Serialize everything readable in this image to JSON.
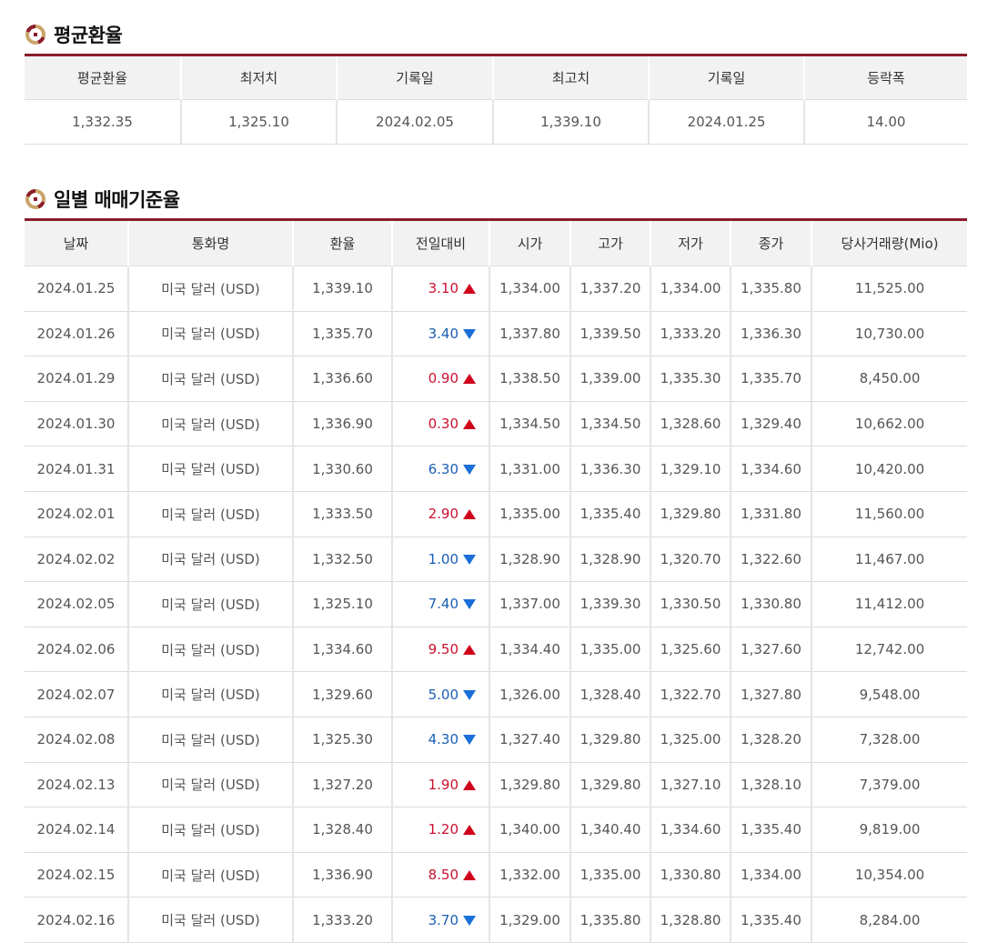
{
  "avg_section": {
    "title": "평균환율",
    "headers": [
      "평균환율",
      "최저치",
      "기록일",
      "최고치",
      "기록일",
      "등락폭"
    ],
    "values": [
      "1,332.35",
      "1,325.10",
      "2024.02.05",
      "1,339.10",
      "2024.01.25",
      "14.00"
    ]
  },
  "daily_section": {
    "title": "일별 매매기준율",
    "headers": [
      "날짜",
      "통화명",
      "환율",
      "전일대비",
      "시가",
      "고가",
      "저가",
      "종가",
      "당사거래량(Mio)"
    ],
    "rows": [
      {
        "date": "2024.01.25",
        "currency": "미국 달러 (USD)",
        "rate": "1,339.10",
        "change": "3.10",
        "direction": "up",
        "open": "1,334.00",
        "high": "1,337.20",
        "low": "1,334.00",
        "close": "1,335.80",
        "volume": "11,525.00"
      },
      {
        "date": "2024.01.26",
        "currency": "미국 달러 (USD)",
        "rate": "1,335.70",
        "change": "3.40",
        "direction": "down",
        "open": "1,337.80",
        "high": "1,339.50",
        "low": "1,333.20",
        "close": "1,336.30",
        "volume": "10,730.00"
      },
      {
        "date": "2024.01.29",
        "currency": "미국 달러 (USD)",
        "rate": "1,336.60",
        "change": "0.90",
        "direction": "up",
        "open": "1,338.50",
        "high": "1,339.00",
        "low": "1,335.30",
        "close": "1,335.70",
        "volume": "8,450.00"
      },
      {
        "date": "2024.01.30",
        "currency": "미국 달러 (USD)",
        "rate": "1,336.90",
        "change": "0.30",
        "direction": "up",
        "open": "1,334.50",
        "high": "1,334.50",
        "low": "1,328.60",
        "close": "1,329.40",
        "volume": "10,662.00"
      },
      {
        "date": "2024.01.31",
        "currency": "미국 달러 (USD)",
        "rate": "1,330.60",
        "change": "6.30",
        "direction": "down",
        "open": "1,331.00",
        "high": "1,336.30",
        "low": "1,329.10",
        "close": "1,334.60",
        "volume": "10,420.00"
      },
      {
        "date": "2024.02.01",
        "currency": "미국 달러 (USD)",
        "rate": "1,333.50",
        "change": "2.90",
        "direction": "up",
        "open": "1,335.00",
        "high": "1,335.40",
        "low": "1,329.80",
        "close": "1,331.80",
        "volume": "11,560.00"
      },
      {
        "date": "2024.02.02",
        "currency": "미국 달러 (USD)",
        "rate": "1,332.50",
        "change": "1.00",
        "direction": "down",
        "open": "1,328.90",
        "high": "1,328.90",
        "low": "1,320.70",
        "close": "1,322.60",
        "volume": "11,467.00"
      },
      {
        "date": "2024.02.05",
        "currency": "미국 달러 (USD)",
        "rate": "1,325.10",
        "change": "7.40",
        "direction": "down",
        "open": "1,337.00",
        "high": "1,339.30",
        "low": "1,330.50",
        "close": "1,330.80",
        "volume": "11,412.00"
      },
      {
        "date": "2024.02.06",
        "currency": "미국 달러 (USD)",
        "rate": "1,334.60",
        "change": "9.50",
        "direction": "up",
        "open": "1,334.40",
        "high": "1,335.00",
        "low": "1,325.60",
        "close": "1,327.60",
        "volume": "12,742.00"
      },
      {
        "date": "2024.02.07",
        "currency": "미국 달러 (USD)",
        "rate": "1,329.60",
        "change": "5.00",
        "direction": "down",
        "open": "1,326.00",
        "high": "1,328.40",
        "low": "1,322.70",
        "close": "1,327.80",
        "volume": "9,548.00"
      },
      {
        "date": "2024.02.08",
        "currency": "미국 달러 (USD)",
        "rate": "1,325.30",
        "change": "4.30",
        "direction": "down",
        "open": "1,327.40",
        "high": "1,329.80",
        "low": "1,325.00",
        "close": "1,328.20",
        "volume": "7,328.00"
      },
      {
        "date": "2024.02.13",
        "currency": "미국 달러 (USD)",
        "rate": "1,327.20",
        "change": "1.90",
        "direction": "up",
        "open": "1,329.80",
        "high": "1,329.80",
        "low": "1,327.10",
        "close": "1,328.10",
        "volume": "7,379.00"
      },
      {
        "date": "2024.02.14",
        "currency": "미국 달러 (USD)",
        "rate": "1,328.40",
        "change": "1.20",
        "direction": "up",
        "open": "1,340.00",
        "high": "1,340.40",
        "low": "1,334.60",
        "close": "1,335.40",
        "volume": "9,819.00"
      },
      {
        "date": "2024.02.15",
        "currency": "미국 달러 (USD)",
        "rate": "1,336.90",
        "change": "8.50",
        "direction": "up",
        "open": "1,332.00",
        "high": "1,335.00",
        "low": "1,330.80",
        "close": "1,334.00",
        "volume": "10,354.00"
      },
      {
        "date": "2024.02.16",
        "currency": "미국 달러 (USD)",
        "rate": "1,333.20",
        "change": "3.70",
        "direction": "down",
        "open": "1,329.00",
        "high": "1,335.80",
        "low": "1,328.80",
        "close": "1,335.40",
        "volume": "8,284.00"
      }
    ]
  },
  "colors": {
    "accent": "#8b1c2c",
    "up": "#c8102e",
    "down": "#1a5fb4",
    "header_bg": "#f2f2f2"
  },
  "icons": {
    "section_icon": "coin-ring-icon",
    "up_arrow": "triangle-up-icon",
    "down_arrow": "triangle-down-icon"
  }
}
